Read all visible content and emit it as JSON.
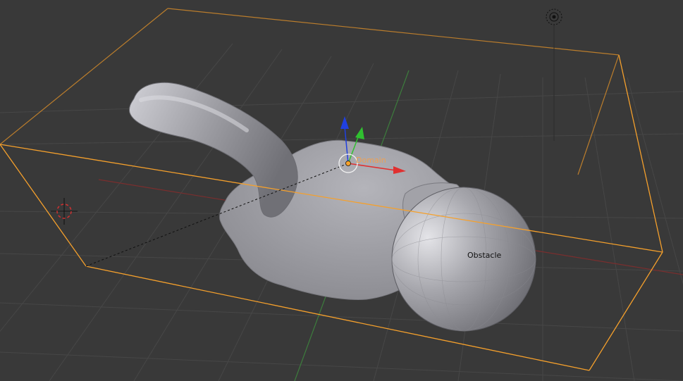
{
  "viewport": {
    "background": "#393939",
    "grid_color": "#474747",
    "axis_x_color": "#7a2e2e",
    "axis_y_color": "#3d7d3d",
    "selection_color": "#f5a02c"
  },
  "objects": {
    "domain": {
      "label": "Domain",
      "label_color": "#f0a050"
    },
    "obstacle": {
      "label": "Obstacle",
      "label_color": "#101010"
    }
  },
  "icons": {
    "lamp": "lamp-icon",
    "cursor": "3d-cursor-icon",
    "origin": "object-origin-icon",
    "gizmo": "transform-gizmo"
  },
  "gizmo": {
    "x_color": "#e03030",
    "y_color": "#30c030",
    "z_color": "#2040e0"
  }
}
